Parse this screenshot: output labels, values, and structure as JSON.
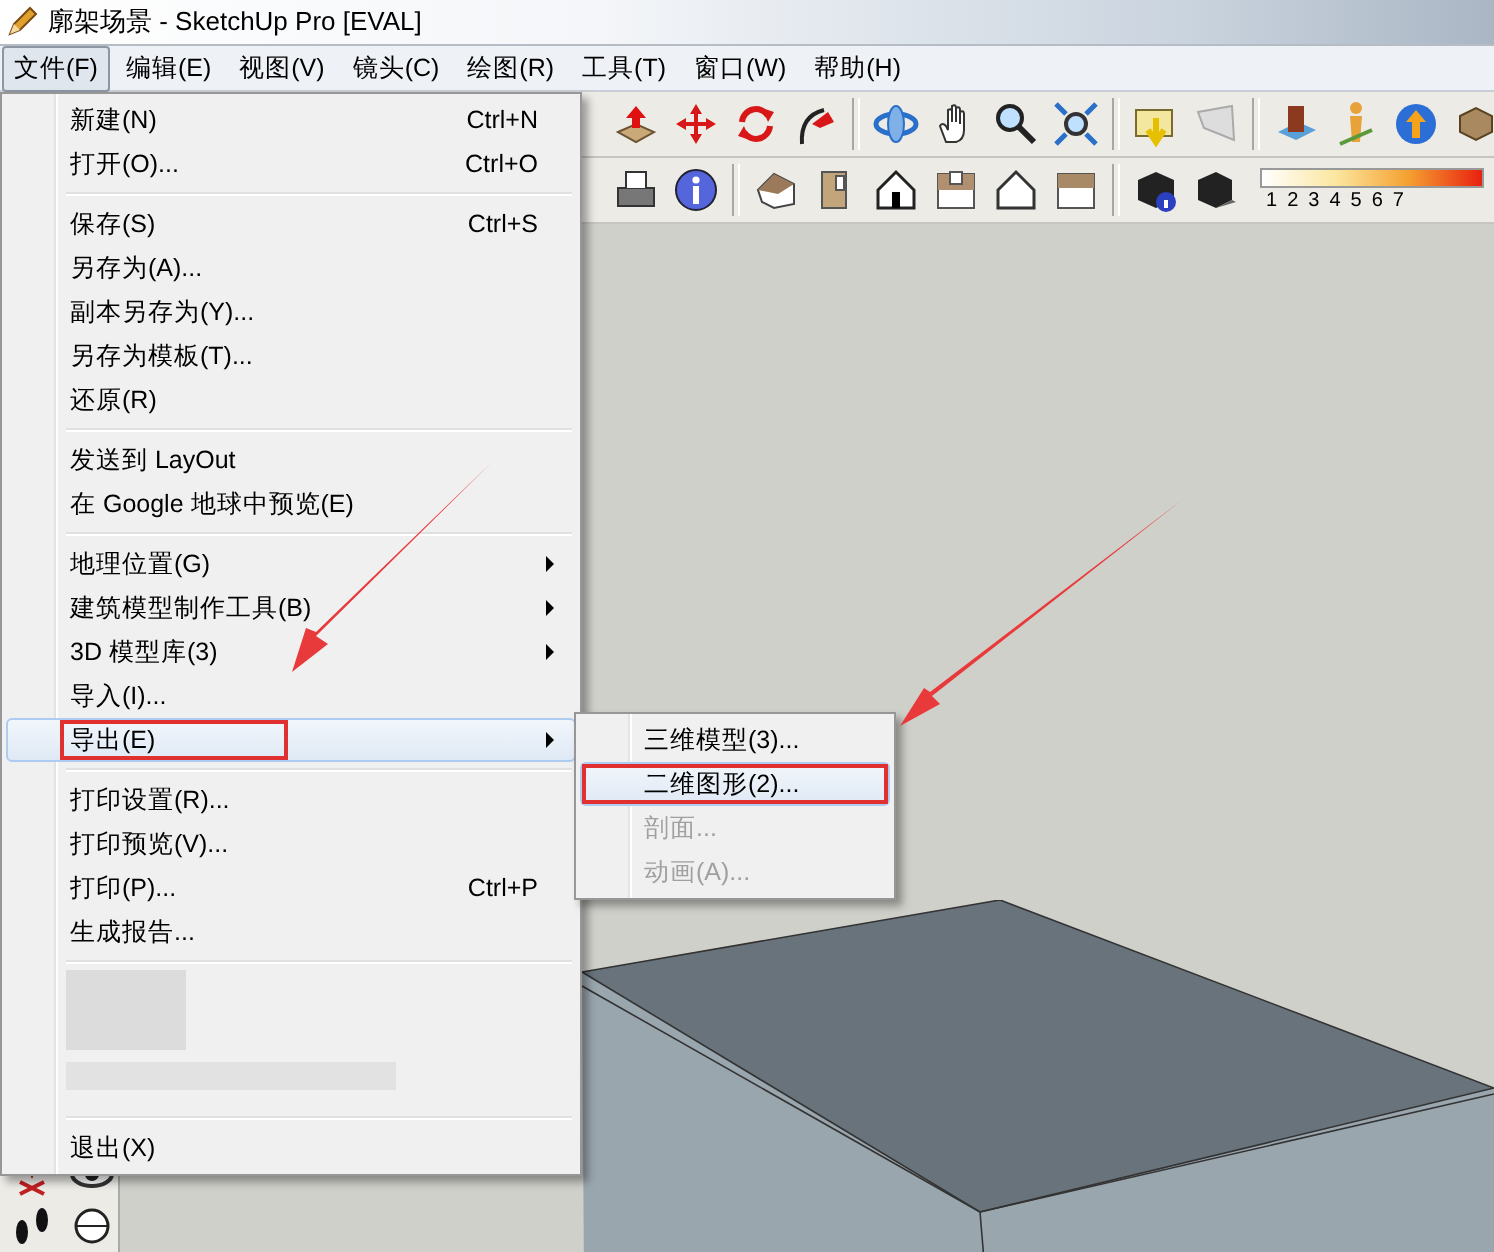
{
  "window": {
    "title": "廓架场景 - SketchUp Pro [EVAL]"
  },
  "menu_bar": [
    {
      "label": "文件(F)",
      "selected": true
    },
    {
      "label": "编辑(E)",
      "selected": false
    },
    {
      "label": "视图(V)",
      "selected": false
    },
    {
      "label": "镜头(C)",
      "selected": false
    },
    {
      "label": "绘图(R)",
      "selected": false
    },
    {
      "label": "工具(T)",
      "selected": false
    },
    {
      "label": "窗口(W)",
      "selected": false
    },
    {
      "label": "帮助(H)",
      "selected": false
    }
  ],
  "file_menu": {
    "items": [
      {
        "kind": "item",
        "label": "新建(N)",
        "shortcut": "Ctrl+N",
        "submenu": false,
        "selected": false,
        "disabled": false,
        "annotated": false
      },
      {
        "kind": "item",
        "label": "打开(O)...",
        "shortcut": "Ctrl+O",
        "submenu": false,
        "selected": false,
        "disabled": false,
        "annotated": false
      },
      {
        "kind": "separator"
      },
      {
        "kind": "item",
        "label": "保存(S)",
        "shortcut": "Ctrl+S",
        "submenu": false,
        "selected": false,
        "disabled": false,
        "annotated": false
      },
      {
        "kind": "item",
        "label": "另存为(A)...",
        "submenu": false,
        "selected": false,
        "disabled": false,
        "annotated": false
      },
      {
        "kind": "item",
        "label": "副本另存为(Y)...",
        "submenu": false,
        "selected": false,
        "disabled": false,
        "annotated": false
      },
      {
        "kind": "item",
        "label": "另存为模板(T)...",
        "submenu": false,
        "selected": false,
        "disabled": false,
        "annotated": false
      },
      {
        "kind": "item",
        "label": "还原(R)",
        "submenu": false,
        "selected": false,
        "disabled": false,
        "annotated": false
      },
      {
        "kind": "separator"
      },
      {
        "kind": "item",
        "label": "发送到 LayOut",
        "submenu": false,
        "selected": false,
        "disabled": false,
        "annotated": false
      },
      {
        "kind": "item",
        "label": "在 Google 地球中预览(E)",
        "submenu": false,
        "selected": false,
        "disabled": false,
        "annotated": false
      },
      {
        "kind": "separator"
      },
      {
        "kind": "item",
        "label": "地理位置(G)",
        "submenu": true,
        "selected": false,
        "disabled": false,
        "annotated": false
      },
      {
        "kind": "item",
        "label": "建筑模型制作工具(B)",
        "submenu": true,
        "selected": false,
        "disabled": false,
        "annotated": false
      },
      {
        "kind": "item",
        "label": "3D 模型库(3)",
        "submenu": true,
        "selected": false,
        "disabled": false,
        "annotated": false
      },
      {
        "kind": "item",
        "label": "导入(I)...",
        "submenu": false,
        "selected": false,
        "disabled": false,
        "annotated": false
      },
      {
        "kind": "item",
        "label": "导出(E)",
        "submenu": true,
        "selected": true,
        "disabled": false,
        "annotated": true
      },
      {
        "kind": "separator"
      },
      {
        "kind": "item",
        "label": "打印设置(R)...",
        "submenu": false,
        "selected": false,
        "disabled": false,
        "annotated": false
      },
      {
        "kind": "item",
        "label": "打印预览(V)...",
        "submenu": false,
        "selected": false,
        "disabled": false,
        "annotated": false
      },
      {
        "kind": "item",
        "label": "打印(P)...",
        "shortcut": "Ctrl+P",
        "submenu": false,
        "selected": false,
        "disabled": false,
        "annotated": false
      },
      {
        "kind": "item",
        "label": "生成报告...",
        "submenu": false,
        "selected": false,
        "disabled": false,
        "annotated": false
      },
      {
        "kind": "separator"
      },
      {
        "kind": "redacted"
      },
      {
        "kind": "separator"
      },
      {
        "kind": "item",
        "label": "退出(X)",
        "submenu": false,
        "selected": false,
        "disabled": false,
        "annotated": false
      }
    ]
  },
  "export_submenu": {
    "items": [
      {
        "kind": "item",
        "label": "三维模型(3)...",
        "submenu": false,
        "selected": false,
        "disabled": false,
        "annotated": false
      },
      {
        "kind": "item",
        "label": "二维图形(2)...",
        "submenu": false,
        "selected": true,
        "disabled": false,
        "annotated": true
      },
      {
        "kind": "item",
        "label": "剖面...",
        "submenu": false,
        "selected": false,
        "disabled": true,
        "annotated": false
      },
      {
        "kind": "item",
        "label": "动画(A)...",
        "submenu": false,
        "selected": false,
        "disabled": true,
        "annotated": false
      }
    ]
  },
  "toolbar": {
    "scale_labels": [
      "1",
      "2",
      "3",
      "4",
      "5",
      "6",
      "7"
    ]
  }
}
